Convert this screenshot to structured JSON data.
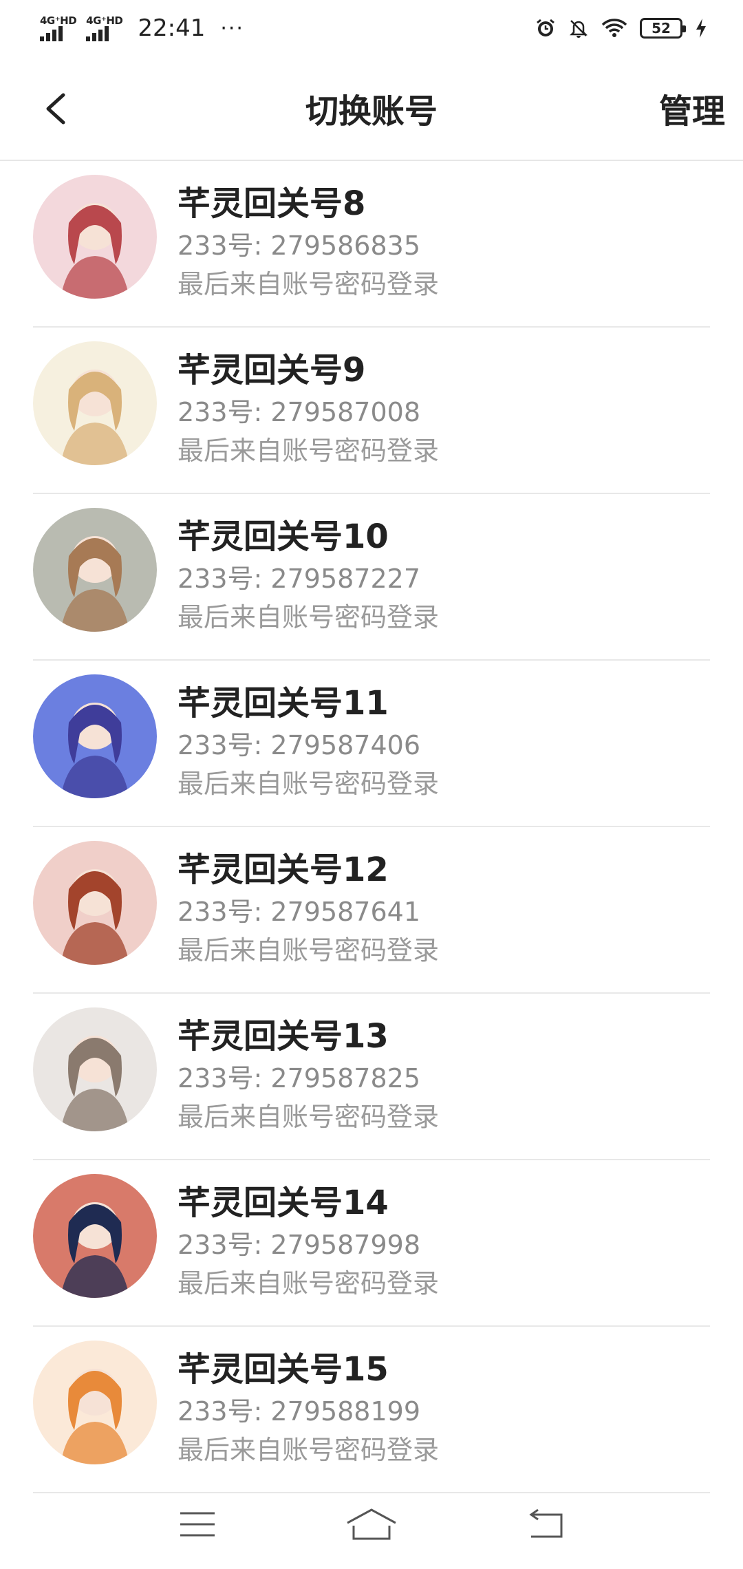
{
  "status_bar": {
    "network1": "4G⁺HD",
    "network2": "4G⁺HD",
    "time": "22:41",
    "dots": "···",
    "battery": "52",
    "icons": [
      "alarm-icon",
      "mute-bell-icon",
      "wifi-icon",
      "battery-icon",
      "charging-icon"
    ]
  },
  "header": {
    "title": "切换账号",
    "manage": "管理"
  },
  "accounts": [
    {
      "name": "芊灵回关号8",
      "uid": "233号: 279586835",
      "login": "最后来自账号密码登录",
      "colors": [
        "#b9484d",
        "#f3d8dc"
      ]
    },
    {
      "name": "芊灵回关号9",
      "uid": "233号: 279587008",
      "login": "最后来自账号密码登录",
      "colors": [
        "#d9b27a",
        "#f6f0df"
      ]
    },
    {
      "name": "芊灵回关号10",
      "uid": "233号: 279587227",
      "login": "最后来自账号密码登录",
      "colors": [
        "#a77a55",
        "#b9bbb1"
      ]
    },
    {
      "name": "芊灵回关号11",
      "uid": "233号: 279587406",
      "login": "最后来自账号密码登录",
      "colors": [
        "#3f3d9a",
        "#6b7fe0"
      ]
    },
    {
      "name": "芊灵回关号12",
      "uid": "233号: 279587641",
      "login": "最后来自账号密码登录",
      "colors": [
        "#a3442c",
        "#f0cfc9"
      ]
    },
    {
      "name": "芊灵回关号13",
      "uid": "233号: 279587825",
      "login": "最后来自账号密码登录",
      "colors": [
        "#8a7a6e",
        "#eae6e3"
      ]
    },
    {
      "name": "芊灵回关号14",
      "uid": "233号: 279587998",
      "login": "最后来自账号密码登录",
      "colors": [
        "#1f2b52",
        "#d87a6a"
      ]
    },
    {
      "name": "芊灵回关号15",
      "uid": "233号: 279588199",
      "login": "最后来自账号密码登录",
      "colors": [
        "#e88a3a",
        "#fbe9d8"
      ]
    }
  ],
  "navbar": [
    "menu-icon",
    "home-icon",
    "back-nav-icon"
  ]
}
